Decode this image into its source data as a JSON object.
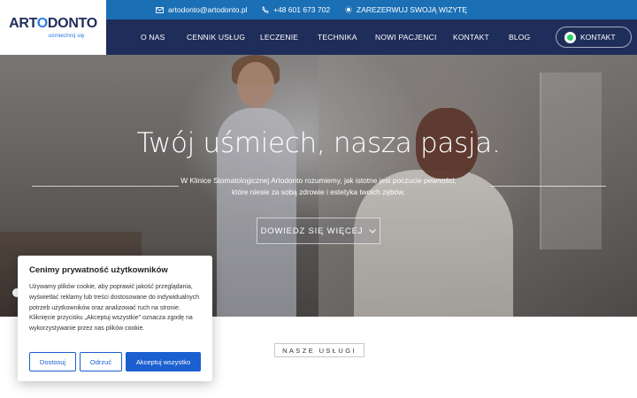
{
  "logo": {
    "brand_pre": "ART",
    "brand_o": "O",
    "brand_post": "DONTO",
    "tagline": "uśmiechnij się"
  },
  "topbar": {
    "email": "artodonto@artodonto.pl",
    "phone": "+48 601 673 702",
    "book": "ZAREZERWUJ SWOJĄ WIZYTĘ"
  },
  "nav": {
    "items": [
      "O NAS",
      "CENNIK USŁUG",
      "LECZENIE",
      "TECHNIKA",
      "NOWI PACJENCI",
      "KONTAKT",
      "BLOG"
    ],
    "contact_button": "KONTAKT"
  },
  "hero": {
    "title": "Twój uśmiech, nasza pasja.",
    "text": "W Klinice Stomatologicznej Artodonto rozumiemy, jak istotne jest poczucie pewności, które niesie za sobą zdrowie i estetyka twoich zębów.",
    "cta": "DOWIEDZ SIĘ WIĘCEJ"
  },
  "section": {
    "services_badge": "NASZE USŁUGI"
  },
  "cookie": {
    "title": "Cenimy prywatność użytkowników",
    "body": "Używamy plików cookie, aby poprawić jakość przeglądania, wyświetlać reklamy lub treści dostosowane do indywidualnych potrzeb użytkowników oraz analizować ruch na stronie. Kliknięcie przycisku „Akceptuj wszystkie” oznacza zgodę na wykorzystywanie przez nas plików cookie.",
    "customize": "Dostosuj",
    "reject": "Odrzuć",
    "accept": "Akceptuj wszystko"
  },
  "colors": {
    "topbar": "#1b6fb5",
    "nav": "#1f2d5a",
    "accent": "#1b5fd0"
  }
}
